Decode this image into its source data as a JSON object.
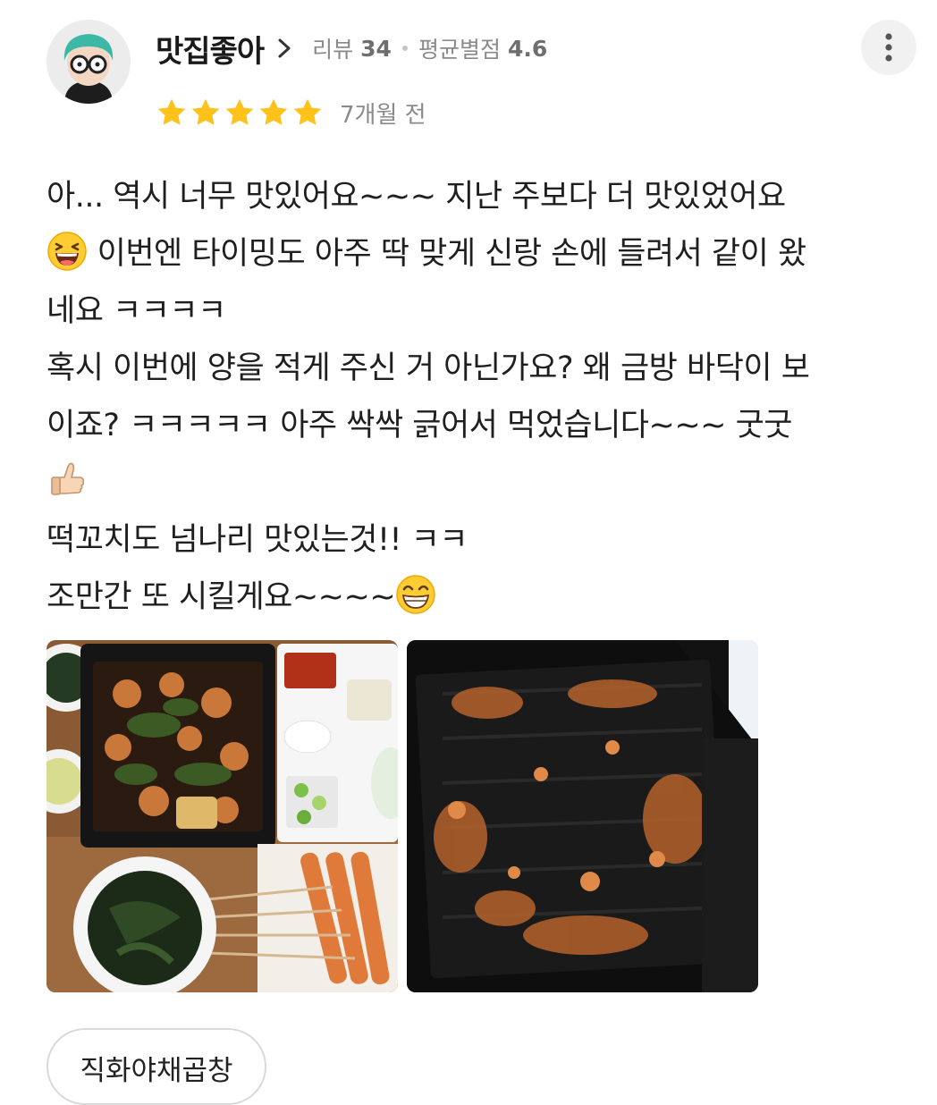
{
  "reviewer": {
    "name": "맛집좋아",
    "review_label": "리뷰",
    "review_count": "34",
    "avg_label": "평균별점",
    "avg_rating": "4.6"
  },
  "review": {
    "stars": 5,
    "date": "7개월 전",
    "lines": {
      "l1": "아... 역시 너무 맛있어요~~~ 지난 주보다 더 맛있었어요",
      "l2": " 이번엔 타이밍도 아주 딱 맞게 신랑 손에 들려서 같이 왔",
      "l3": "네요 ㅋㅋㅋㅋ",
      "l4": "혹시 이번에 양을 적게 주신 거 아닌가요? 왜 금방 바닥이 보",
      "l5": "이죠? ㅋㅋㅋㅋㅋ 아주 싹싹 긁어서 먹었습니다~~~ 굿굿",
      "l7": "떡꼬치도 넘나리 맛있는것!! ㅋㅋ",
      "l8": "조만간 또 시킬게요~~~~"
    }
  },
  "photos": [
    {
      "icon": "food-photo-full-meal"
    },
    {
      "icon": "food-photo-empty-tray"
    }
  ],
  "menu_tag": "직화야채곱창",
  "colors": {
    "star": "#ffc21a",
    "meta_text": "#8a8a8a",
    "chip_border": "#d9d9d9"
  }
}
